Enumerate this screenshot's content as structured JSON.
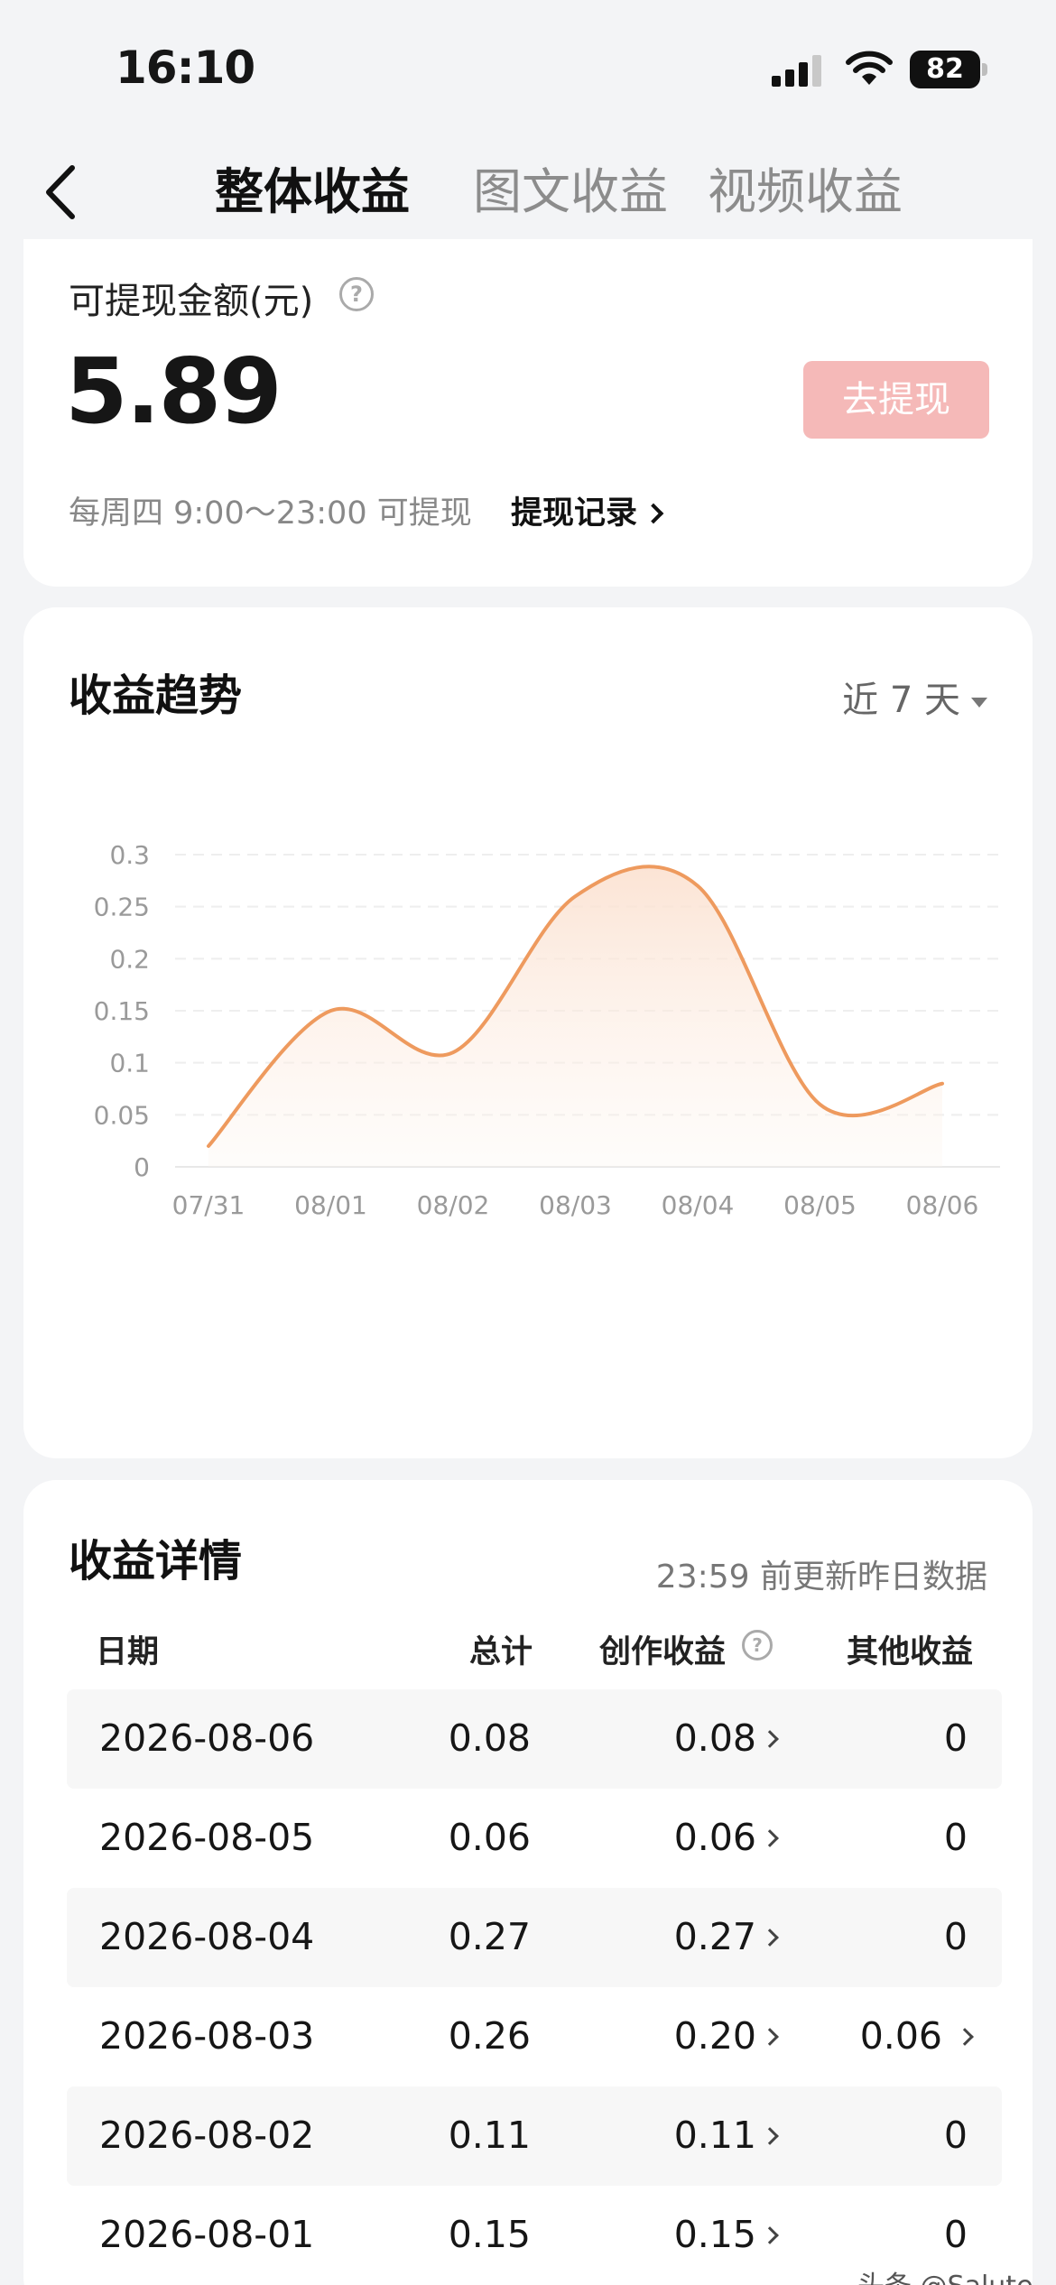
{
  "status_bar": {
    "time": "16:10",
    "battery": "82"
  },
  "nav": {
    "tabs": [
      {
        "label": "整体收益",
        "active": true
      },
      {
        "label": "图文收益",
        "active": false
      },
      {
        "label": "视频收益",
        "active": false
      }
    ]
  },
  "withdraw": {
    "label": "可提现金额(元)",
    "help": "?",
    "amount": "5.89",
    "button": "去提现",
    "hint": "每周四 9:00～23:00 可提现",
    "record_link": "提现记录"
  },
  "trend": {
    "title": "收益趋势",
    "range": "近 7 天",
    "line_color": "#ee9a5e"
  },
  "chart_data": {
    "type": "area",
    "x": [
      "07/31",
      "08/01",
      "08/02",
      "08/03",
      "08/04",
      "08/05",
      "08/06"
    ],
    "y_ticks": [
      "0",
      "0.05",
      "0.1",
      "0.15",
      "0.2",
      "0.25",
      "0.3"
    ],
    "ylim": [
      0,
      0.3
    ],
    "series": [
      {
        "values": [
          0.02,
          0.15,
          0.11,
          0.26,
          0.27,
          0.06,
          0.08
        ]
      }
    ],
    "grid": true
  },
  "detail": {
    "title": "收益详情",
    "update_note": "23:59 前更新昨日数据",
    "headers": {
      "date": "日期",
      "total": "总计",
      "create": "创作收益",
      "other": "其他收益"
    },
    "rows": [
      {
        "date": "2026-08-06",
        "total": "0.08",
        "create": "0.08",
        "other": "0"
      },
      {
        "date": "2026-08-05",
        "total": "0.06",
        "create": "0.06",
        "other": "0"
      },
      {
        "date": "2026-08-04",
        "total": "0.27",
        "create": "0.27",
        "other": "0"
      },
      {
        "date": "2026-08-03",
        "total": "0.26",
        "create": "0.20",
        "other": "0.06"
      },
      {
        "date": "2026-08-02",
        "total": "0.11",
        "create": "0.11",
        "other": "0"
      },
      {
        "date": "2026-08-01",
        "total": "0.15",
        "create": "0.15",
        "other": "0"
      }
    ]
  },
  "watermark": "头条 @Salute"
}
